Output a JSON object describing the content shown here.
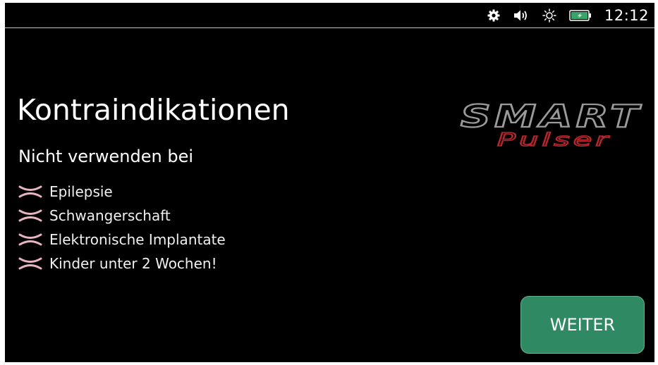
{
  "status_bar": {
    "icons": [
      "settings-gear-icon",
      "speaker-volume-icon",
      "brightness-sun-icon",
      "battery-charging-icon"
    ],
    "time": "12:12"
  },
  "screen": {
    "title": "Kontraindikationen",
    "subtitle": "Nicht verwenden bei",
    "items": [
      {
        "label": "Epilepsie",
        "icon": "cross-mark-icon"
      },
      {
        "label": "Schwangerschaft",
        "icon": "cross-mark-icon"
      },
      {
        "label": "Elektronische Implantate",
        "icon": "cross-mark-icon"
      },
      {
        "label": "Kinder unter 2 Wochen!",
        "icon": "cross-mark-icon"
      }
    ]
  },
  "logo": {
    "line1": "SMART",
    "line2": "Pulser"
  },
  "actions": {
    "next_label": "WEITER"
  },
  "colors": {
    "background": "#000000",
    "button": "#2f8a63",
    "cross_mark": "#e8b4bf",
    "logo_primary": "#9a9a9a",
    "logo_accent": "#b3262e"
  }
}
